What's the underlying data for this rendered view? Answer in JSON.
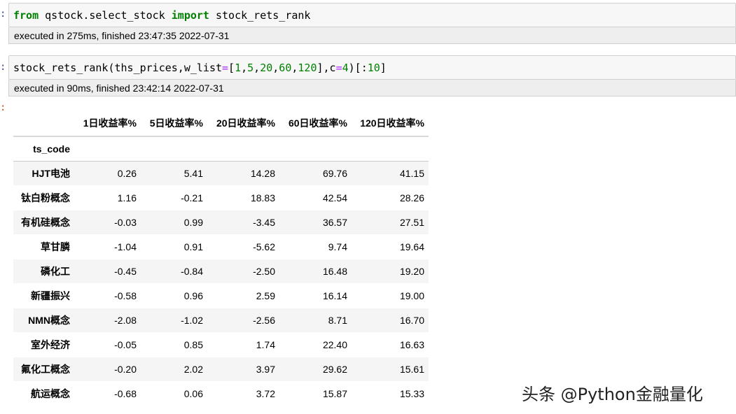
{
  "cells": [
    {
      "code": {
        "kw1": "from",
        "module": " qstock.select_stock ",
        "kw2": "import",
        "name": " stock_rets_rank"
      },
      "exec_info": "executed in 275ms, finished 23:47:35 2022-07-31"
    },
    {
      "code": {
        "func": "stock_rets_rank(ths_prices,w_list",
        "eq": "=",
        "list_open": "[",
        "n1": "1",
        "sep1": ",",
        "n2": "5",
        "sep2": ",",
        "n3": "20",
        "sep3": ",",
        "n4": "60",
        "sep4": ",",
        "n5": "120",
        "list_close": "],c",
        "eq2": "=",
        "n6": "4",
        "tail": ")[:",
        "n7": "10",
        "end": "]"
      },
      "exec_info": "executed in 90ms, finished 23:42:14 2022-07-31"
    }
  ],
  "table": {
    "columns": [
      "1日收益率%",
      "5日收益率%",
      "20日收益率%",
      "60日收益率%",
      "120日收益率%"
    ],
    "index_name": "ts_code",
    "rows": [
      {
        "name": "HJT电池",
        "values": [
          "0.26",
          "5.41",
          "14.28",
          "69.76",
          "41.15"
        ]
      },
      {
        "name": "钛白粉概念",
        "values": [
          "1.16",
          "-0.21",
          "18.83",
          "42.54",
          "28.26"
        ]
      },
      {
        "name": "有机硅概念",
        "values": [
          "-0.03",
          "0.99",
          "-3.45",
          "36.57",
          "27.51"
        ]
      },
      {
        "name": "草甘膦",
        "values": [
          "-1.04",
          "0.91",
          "-5.62",
          "9.74",
          "19.64"
        ]
      },
      {
        "name": "磷化工",
        "values": [
          "-0.45",
          "-0.84",
          "-2.50",
          "16.48",
          "19.20"
        ]
      },
      {
        "name": "新疆振兴",
        "values": [
          "-0.58",
          "0.96",
          "2.59",
          "16.14",
          "19.00"
        ]
      },
      {
        "name": "NMN概念",
        "values": [
          "-2.08",
          "-1.02",
          "-2.56",
          "8.71",
          "16.70"
        ]
      },
      {
        "name": "室外经济",
        "values": [
          "-0.05",
          "0.85",
          "1.74",
          "22.40",
          "16.63"
        ]
      },
      {
        "name": "氟化工概念",
        "values": [
          "-0.20",
          "2.02",
          "3.97",
          "29.62",
          "15.61"
        ]
      },
      {
        "name": "航运概念",
        "values": [
          "-0.68",
          "0.06",
          "3.72",
          "15.87",
          "15.33"
        ]
      }
    ]
  },
  "watermark": "头条 @Python金融量化",
  "colors": {
    "keyword": "#008000",
    "number": "#008000",
    "operator": "#aa22ff",
    "prompt": "#303f9f",
    "stripe": "#f5f5f5"
  }
}
